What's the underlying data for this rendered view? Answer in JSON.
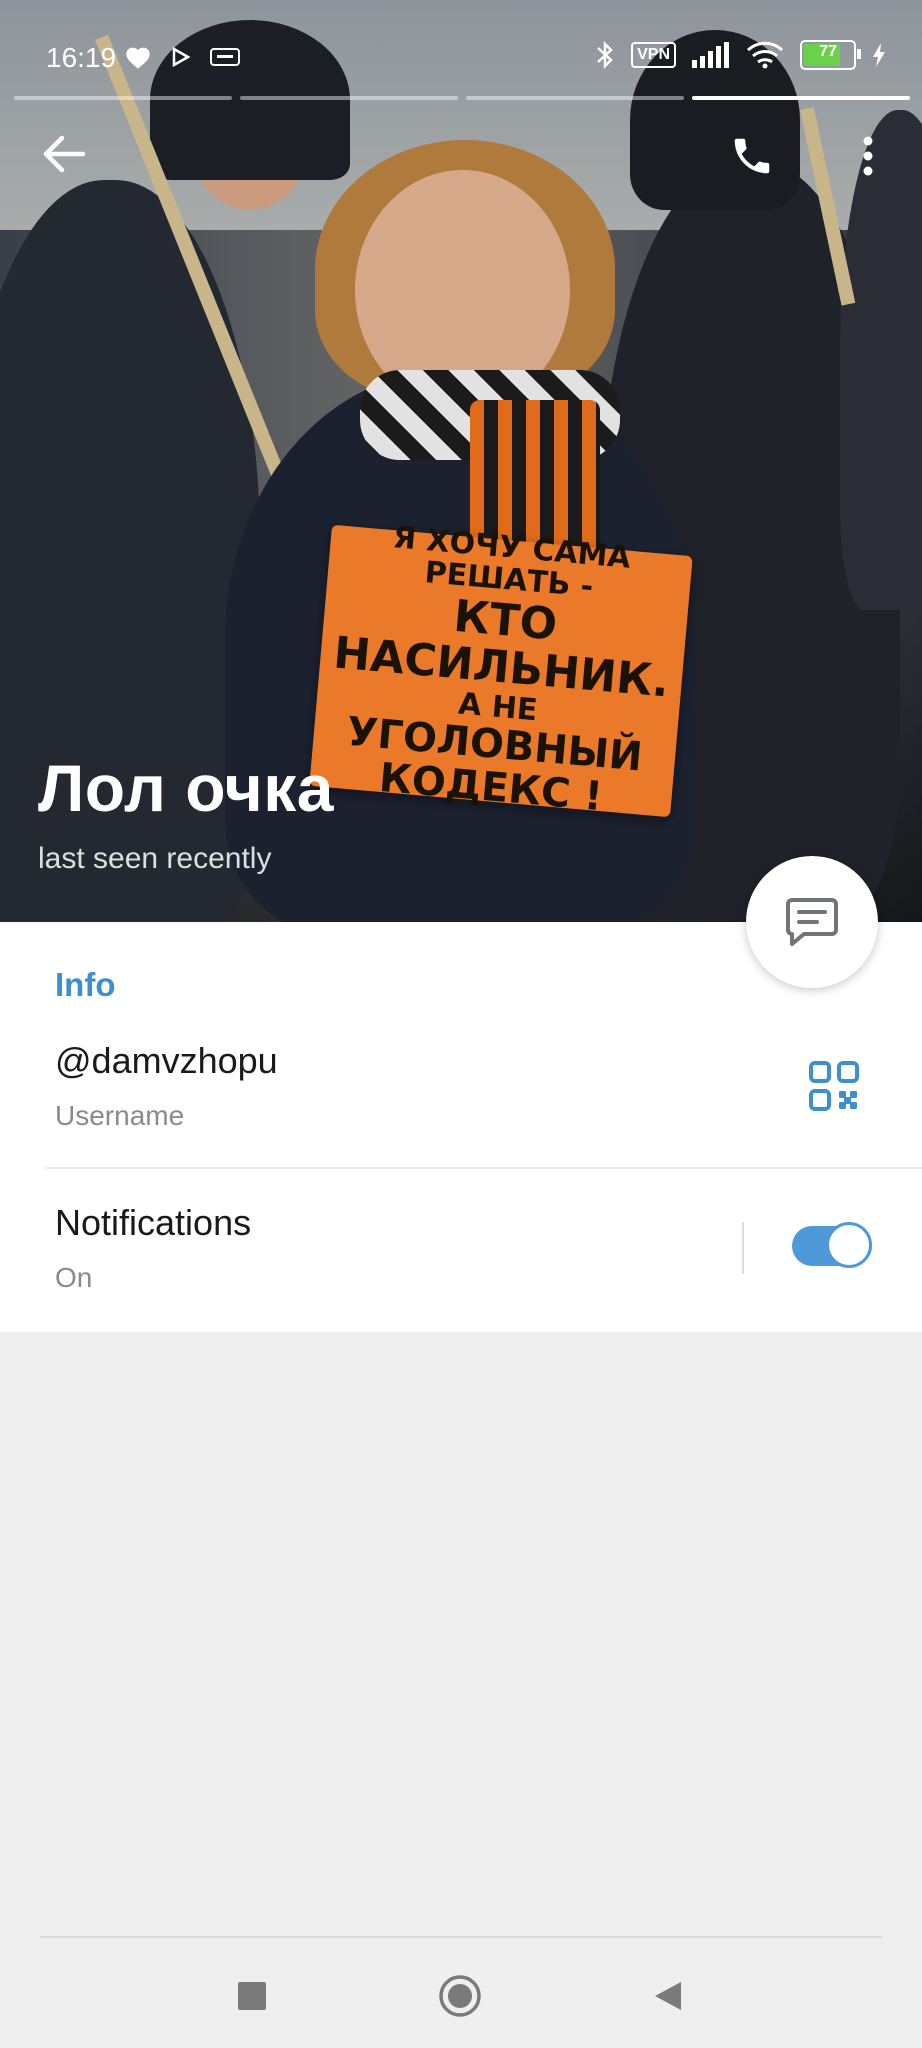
{
  "status_bar": {
    "time": "16:19",
    "vpn_label": "VPN",
    "battery_level": "77"
  },
  "story_progress": {
    "segments": 5,
    "active_index": 4
  },
  "profile": {
    "name": "Лол очка",
    "status": "last seen recently"
  },
  "photo_sign": {
    "line1": "Я ХОЧУ САМА РЕШАТЬ -",
    "line2": "КТО НАСИЛЬНИК.",
    "line3": "А НЕ",
    "line4": "УГОЛОВНЫЙ",
    "line5": "КОДЕКС !"
  },
  "info": {
    "section_title": "Info",
    "username_value": "@damvzhopu",
    "username_label": "Username",
    "notifications_label": "Notifications",
    "notifications_value": "On",
    "notifications_enabled": true
  },
  "colors": {
    "accent": "#3d8fd0",
    "toggle_on": "#4e9ad8",
    "background": "#efefef"
  },
  "icons": {
    "back": "arrow-left-icon",
    "call": "phone-icon",
    "more": "more-vertical-icon",
    "message": "message-icon",
    "qr": "qr-code-icon"
  }
}
